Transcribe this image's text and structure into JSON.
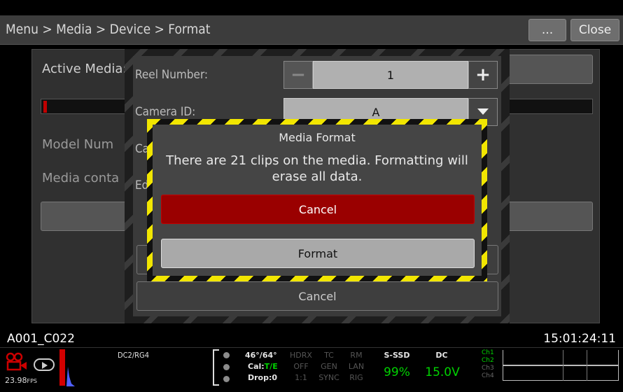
{
  "titlebar": {
    "breadcrumb": "Menu > Media > Device > Format",
    "more_label": "...",
    "close_label": "Close"
  },
  "background_menu": {
    "active_media_label": "Active Media:",
    "model_number_label": "Model Num",
    "media_contents_label": "Media conta"
  },
  "format_dialog": {
    "reel_number_label": "Reel Number:",
    "reel_number_value": "1",
    "minus_label": "−",
    "plus_label": "+",
    "camera_id_label": "Camera ID:",
    "camera_id_value": "A",
    "row3_label_partial": "Ca",
    "row4_label_partial": "Ed",
    "cancel_label": "Cancel"
  },
  "confirm_dialog": {
    "title": "Media Format",
    "message": "There are 21 clips on the media. Formatting will erase all data.",
    "cancel_label": "Cancel",
    "format_label": "Format"
  },
  "overlay": {
    "clip_name": "A001_C022",
    "timecode": "15:01:24:11"
  },
  "statusbar": {
    "fps": "23.98",
    "fps_unit": "FPS",
    "color_science": "DC2/RG4",
    "shutter": "46°/64°",
    "cal_label": "Cal:",
    "cal_value": "T/E",
    "drop": "Drop:0",
    "hdrx": "HDRX",
    "hdrx_value": "OFF",
    "hdrx_ratio": "1:1",
    "tc": "TC",
    "tc_value": "GEN",
    "tc_sync": "SYNC",
    "rm": "RM",
    "rm_value": "LAN",
    "rm_rig": "RIG",
    "media_type": "S-SSD",
    "media_percent": "99%",
    "power_type": "DC",
    "power_voltage": "15.0V",
    "channels": [
      "Ch1",
      "Ch2",
      "Ch3",
      "Ch4"
    ],
    "colors": {
      "active_green": "#00d200",
      "record_red": "#cc0000"
    }
  }
}
